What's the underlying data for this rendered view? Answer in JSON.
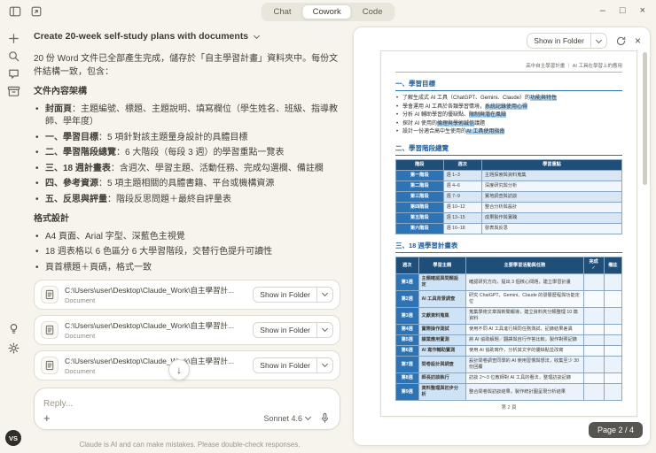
{
  "window": {
    "tabs": [
      "Chat",
      "Cowork",
      "Code"
    ],
    "active_tab": "Cowork"
  },
  "icons": {
    "minimize": "–",
    "maximize": "□",
    "close": "×",
    "panel_close": "×",
    "scroll_down": "↓"
  },
  "sidebar": {
    "avatar": "VS"
  },
  "chat": {
    "title": "Create 20-week self-study plans with documents",
    "intro": "20 份 Word 文件已全部產生完成，儲存於「自主學習計畫」資料夾中。每份文件結構一致，包含：",
    "structure_title": "文件內容架構",
    "structure_items": [
      {
        "label": "封面頁",
        "text": "：主題編號、標題、主題說明、填寫欄位（學生姓名、班級、指導教師、學年度）"
      },
      {
        "label": "一、學習目標",
        "text": "：5 項針對該主題量身設計的具體目標"
      },
      {
        "label": "二、學習階段總覽",
        "text": "：6 大階段（每段 3 週）的學習重點一覽表"
      },
      {
        "label": "三、18 週計畫表",
        "text": "：含週次、學習主題、活動任務、完成勾選欄、備註欄"
      },
      {
        "label": "四、參考資源",
        "text": "：5 項主題相關的具體書籍、平台或機構資源"
      },
      {
        "label": "五、反思與評量",
        "text": "：階段反思問題＋最終自評量表"
      }
    ],
    "format_title": "格式設計",
    "format_items": [
      "A4 頁面、Arial 字型、深藍色主視覺",
      "18 週表格以 6 色區分 6 大學習階段，交替行色提升可讀性",
      "頁首標題＋頁碼，格式一致"
    ],
    "files": [
      {
        "path": "C:\\Users\\user\\Desktop\\Claude_Work\\自主學習計...",
        "type": "Document",
        "button": "Show in Folder"
      },
      {
        "path": "C:\\Users\\user\\Desktop\\Claude_Work\\自主學習計...",
        "type": "Document",
        "button": "Show in Folder"
      },
      {
        "path": "C:\\Users\\user\\Desktop\\Claude_Work\\自主學習計...",
        "type": "Document",
        "button": "Show in Folder"
      }
    ],
    "reply_placeholder": "Reply...",
    "model": "Sonnet 4.6",
    "footer": "Claude is AI and can make mistakes. Please double-check responses."
  },
  "preview": {
    "show_in_folder": "Show in Folder",
    "page_badge": "Page 2 / 4",
    "doc": {
      "header": "高中自主學習計畫 ｜ AI 工具在學習上的應用",
      "h1": "一、學習目標",
      "goals": [
        {
          "pre": "了解生成式 AI 工具（ChatGPT、Gemini、Claude）的",
          "hl": "功能與特性",
          "post": ""
        },
        {
          "pre": "學會運用 AI 工具於各類學習情境，",
          "hl": "系統記錄使用心得",
          "post": ""
        },
        {
          "pre": "分析 AI 輔助學習的優缺點、",
          "hl": "限制與潛在風險",
          "post": ""
        },
        {
          "pre": "探討 AI 使用的",
          "hl": "倫理與學術誠信",
          "post": "議題"
        },
        {
          "pre": "設計一份適合高中生使用的",
          "hl": "AI 工具使用指南",
          "post": ""
        }
      ],
      "h2": "二、學習階段總覽",
      "stage_table": {
        "headers": [
          "階段",
          "週次",
          "學習重點"
        ],
        "rows": [
          {
            "stage": "第一階段",
            "weeks": "週 1–3",
            "focus": "主題探索與資料蒐集"
          },
          {
            "stage": "第二階段",
            "weeks": "週 4–6",
            "focus": "深度研究與分析"
          },
          {
            "stage": "第三階段",
            "weeks": "週 7–9",
            "focus": "實地調查與訪談"
          },
          {
            "stage": "第四階段",
            "weeks": "週 10–12",
            "focus": "整合分析與設計"
          },
          {
            "stage": "第五階段",
            "weeks": "週 13–15",
            "focus": "成果製作與實踐"
          },
          {
            "stage": "第六階段",
            "weeks": "週 16–18",
            "focus": "發表與反思"
          }
        ]
      },
      "h3": "三、18 週學習計畫表",
      "week_table": {
        "headers": [
          "週次",
          "學習主題",
          "主要學習活動與任務",
          "完成 ✓",
          "備註"
        ],
        "rows": [
          {
            "week": "第1週",
            "topic": "主題確認與問題設定",
            "task": "確認研究方向，提出 3 個核心問題，建立學習計畫"
          },
          {
            "week": "第2週",
            "topic": "AI 工具背景調查",
            "task": "研究 ChatGPT、Gemini、Claude 的發展歷程與功能定位"
          },
          {
            "week": "第3週",
            "topic": "文獻資料蒐集",
            "task": "蒐集學術文章與新聞報導，建立資料夾分類整理 10 篇資料"
          },
          {
            "week": "第4週",
            "topic": "實際操作測試",
            "task": "使用不同 AI 工具進行相同任務測試，記錄結果差異"
          },
          {
            "week": "第5週",
            "topic": "課業應用實測",
            "task": "將 AI 協助解題／翻譯與自行作答比較，製作對照記錄"
          },
          {
            "week": "第6週",
            "topic": "AI 寫作輔助實測",
            "task": "使用 AI 協助寫作，分析其文字的優缺點並改寫"
          },
          {
            "week": "第7週",
            "topic": "問卷設計與調查",
            "task": "設計問卷調查同學的 AI 使用習慣與想法，收集至少 30 份回覆"
          },
          {
            "week": "第8週",
            "topic": "師長訪談執行",
            "task": "訪談 2～3 位教師對 AI 工具的看法，整理訪談記錄"
          },
          {
            "week": "第9週",
            "topic": "資料整理與初步分析",
            "task": "整合問卷與訪談結果，製作統計圖呈現分析結果"
          }
        ]
      },
      "page_footer": "第 2 頁"
    }
  }
}
